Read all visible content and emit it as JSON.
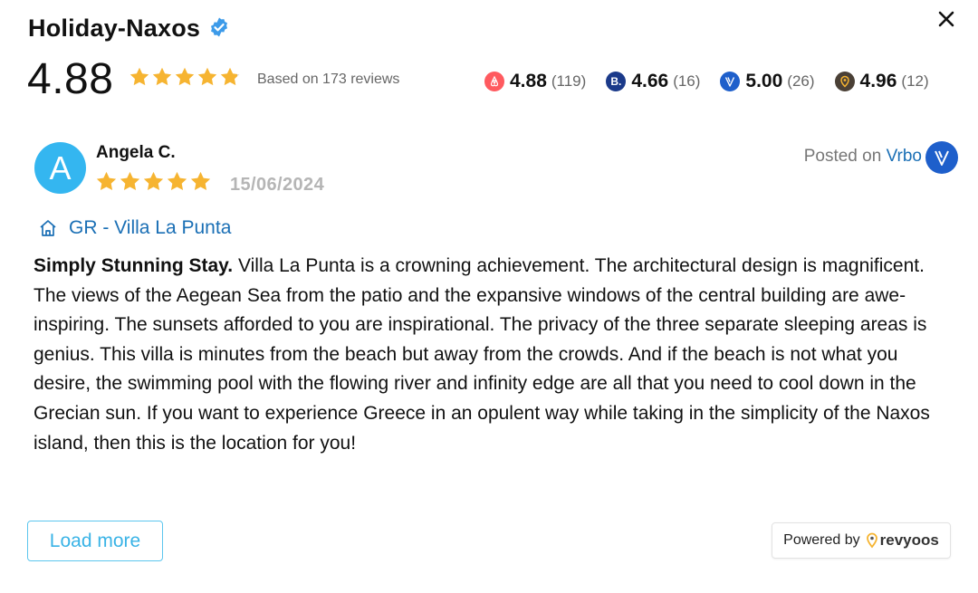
{
  "header": {
    "title": "Holiday-Naxos"
  },
  "summary": {
    "rating": "4.88",
    "stars": 4.88,
    "based_on": "Based on 173 reviews",
    "platforms": [
      {
        "score": "4.88",
        "count": "(119)",
        "icon": "airbnb-icon",
        "color": "#ff5a5f"
      },
      {
        "score": "4.66",
        "count": "(16)",
        "icon": "booking-icon",
        "color": "#1b3a8a"
      },
      {
        "score": "5.00",
        "count": "(26)",
        "icon": "vrbo-icon",
        "color": "#1e5fcb"
      },
      {
        "score": "4.96",
        "count": "(12)",
        "icon": "revyoos-icon",
        "color": "#4a4036"
      }
    ]
  },
  "review": {
    "avatar_initial": "A",
    "author": "Angela C.",
    "stars": 5,
    "date": "15/06/2024",
    "posted_prefix": "Posted on",
    "posted_source": "Vrbo",
    "property": "GR - Villa La Punta",
    "headline": "Simply Stunning Stay.",
    "body": "Villa La Punta is a crowning achievement. The architectural design is magnificent. The views of the Aegean Sea from the patio and the expansive windows of the central building are awe-inspiring. The sunsets afforded to you are inspirational. The privacy of the three separate sleeping areas is genius. This villa is minutes from the beach but away from the crowds. And if the beach is not what you desire, the swimming pool with the flowing river and infinity edge are all that you need to cool down in the Grecian sun. If you want to experience Greece in an opulent way while taking in the simplicity of the Naxos island, then this is the location for you!"
  },
  "footer": {
    "load_more": "Load more",
    "powered_by": "Powered by",
    "brand": "revyoos"
  },
  "colors": {
    "star": "#f6b431",
    "accent": "#34b6f0",
    "link": "#1a6fb5"
  }
}
